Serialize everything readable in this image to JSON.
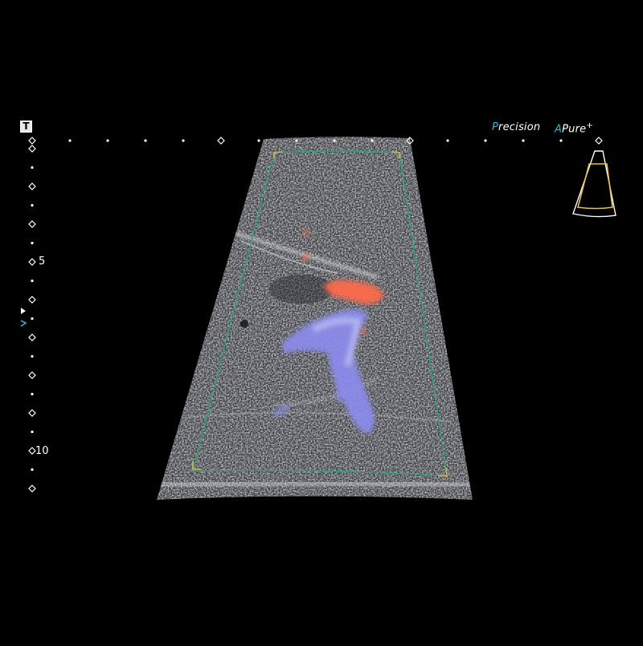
{
  "overlay": {
    "t_marker": "T",
    "brand_precision_accent": "P",
    "brand_precision_rest": "recision",
    "brand_pure_accent": "A",
    "brand_pure_rest": "Pure",
    "brand_pure_plus": "+"
  },
  "depth_scale": {
    "labels": [
      "5",
      "10"
    ]
  },
  "colors": {
    "background": "#000000",
    "accent": "#1fb8c8",
    "roi_box": "#2aa57a",
    "roi_corner": "#d4b84a",
    "doppler_flow_toward": "#ff6a4a",
    "doppler_flow_away": "#8c8cf0",
    "probe_outline": "#ffffff",
    "probe_inner": "#e6c24a"
  },
  "icons": {
    "probe": "convex-probe-icon",
    "focus_marker": "triangle-focus-icon"
  }
}
